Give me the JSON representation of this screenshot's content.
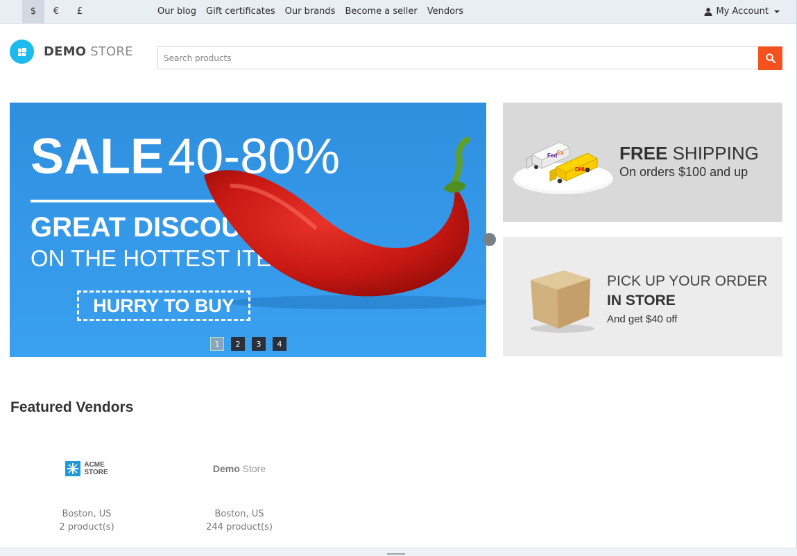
{
  "topbar": {
    "currencies": [
      "$",
      "€",
      "£"
    ],
    "active_currency": "$",
    "links": [
      "Our blog",
      "Gift certificates",
      "Our brands",
      "Become a seller",
      "Vendors"
    ],
    "account_label": "My Account"
  },
  "header": {
    "logo_bold": "DEMO",
    "logo_light": "STORE",
    "search_placeholder": "Search products"
  },
  "hero": {
    "sale_word": "SALE",
    "sale_percent": "40-80%",
    "line1": "GREAT DISCOUNTS",
    "line2": "ON THE HOTTEST ITEMS",
    "cta": "HURRY TO BUY",
    "slides": [
      "1",
      "2",
      "3",
      "4"
    ],
    "active_slide": "1"
  },
  "promos": {
    "shipping_bold": "FREE",
    "shipping_light": "SHIPPING",
    "shipping_sub": "On orders $100 and up",
    "pickup_line1": "PICK UP YOUR ORDER",
    "pickup_line2": "IN STORE",
    "pickup_sub": "And get $40 off"
  },
  "vendors": {
    "title": "Featured Vendors",
    "items": [
      {
        "logo_line1": "ACME",
        "logo_line2": "STORE",
        "location": "Boston, US",
        "products": "2 product(s)"
      },
      {
        "logo_bold": "Demo",
        "logo_light": "Store",
        "location": "Boston, US",
        "products": "244 product(s)"
      }
    ]
  },
  "colors": {
    "accent_search": "#f4511e",
    "logo_blue": "#1cbbef",
    "hero_blue": "#3aa0f0"
  }
}
